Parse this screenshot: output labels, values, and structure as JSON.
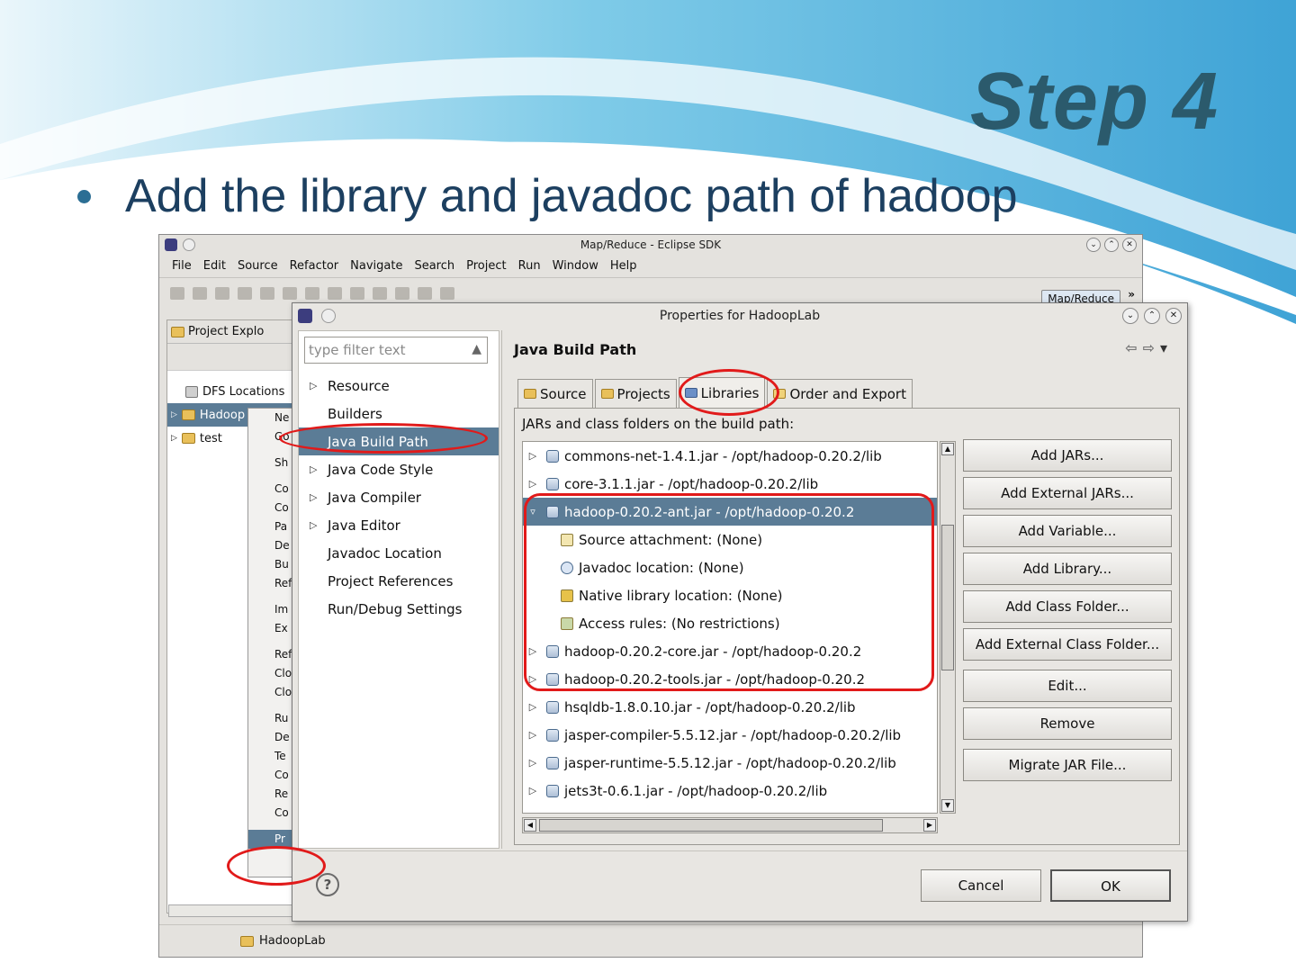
{
  "slide": {
    "title": "Step 4",
    "bullet": "Add the library and javadoc path of hadoop"
  },
  "eclipse": {
    "window_title": "Map/Reduce - Eclipse SDK",
    "menus": [
      "File",
      "Edit",
      "Source",
      "Refactor",
      "Navigate",
      "Search",
      "Project",
      "Run",
      "Window",
      "Help"
    ],
    "perspective": "Map/Reduce",
    "explorer_tab": "Project Explo",
    "tree": [
      {
        "label": "DFS Locations"
      },
      {
        "label": "Hadoop"
      },
      {
        "label": "test"
      }
    ],
    "context_menu": [
      "Ne",
      "Go",
      "Sh",
      "Co",
      "Co",
      "Pa",
      "De",
      "Bu",
      "Ref",
      "Im",
      "Ex",
      "Ref",
      "Clo",
      "Clo",
      "Ru",
      "De",
      "Te",
      "Co",
      "Re",
      "Co",
      "Pr"
    ],
    "status_project": "HadoopLab"
  },
  "dialog": {
    "title": "Properties for HadoopLab",
    "filter_placeholder": "type filter text",
    "nav_items": [
      {
        "label": "Resource",
        "expandable": true
      },
      {
        "label": "Builders",
        "expandable": false
      },
      {
        "label": "Java Build Path",
        "expandable": false,
        "selected": true
      },
      {
        "label": "Java Code Style",
        "expandable": true
      },
      {
        "label": "Java Compiler",
        "expandable": true
      },
      {
        "label": "Java Editor",
        "expandable": true
      },
      {
        "label": "Javadoc Location",
        "expandable": false
      },
      {
        "label": "Project References",
        "expandable": false
      },
      {
        "label": "Run/Debug Settings",
        "expandable": false
      }
    ],
    "page_title": "Java Build Path",
    "tabs": [
      "Source",
      "Projects",
      "Libraries",
      "Order and Export"
    ],
    "active_tab": "Libraries",
    "list_label": "JARs and class folders on the build path:",
    "jars": [
      {
        "label": "commons-net-1.4.1.jar - /opt/hadoop-0.20.2/lib",
        "type": "jar"
      },
      {
        "label": "core-3.1.1.jar - /opt/hadoop-0.20.2/lib",
        "type": "jar"
      },
      {
        "label": "hadoop-0.20.2-ant.jar - /opt/hadoop-0.20.2",
        "type": "jar",
        "expanded": true,
        "selected": true
      },
      {
        "label": "Source attachment: (None)",
        "type": "child"
      },
      {
        "label": "Javadoc location: (None)",
        "type": "child"
      },
      {
        "label": "Native library location: (None)",
        "type": "child"
      },
      {
        "label": "Access rules: (No restrictions)",
        "type": "child"
      },
      {
        "label": "hadoop-0.20.2-core.jar - /opt/hadoop-0.20.2",
        "type": "jar"
      },
      {
        "label": "hadoop-0.20.2-tools.jar - /opt/hadoop-0.20.2",
        "type": "jar"
      },
      {
        "label": "hsqldb-1.8.0.10.jar - /opt/hadoop-0.20.2/lib",
        "type": "jar"
      },
      {
        "label": "jasper-compiler-5.5.12.jar - /opt/hadoop-0.20.2/lib",
        "type": "jar"
      },
      {
        "label": "jasper-runtime-5.5.12.jar - /opt/hadoop-0.20.2/lib",
        "type": "jar"
      },
      {
        "label": "jets3t-0.6.1.jar - /opt/hadoop-0.20.2/lib",
        "type": "jar"
      }
    ],
    "buttons": {
      "add_jars": "Add JARs...",
      "add_external_jars": "Add External JARs...",
      "add_variable": "Add Variable...",
      "add_library": "Add Library...",
      "add_class_folder": "Add Class Folder...",
      "add_external_class_folder": "Add External Class Folder...",
      "edit": "Edit...",
      "remove": "Remove",
      "migrate": "Migrate JAR File..."
    },
    "footer": {
      "help": "?",
      "cancel": "Cancel",
      "ok": "OK"
    }
  },
  "colors": {
    "title": "#2b5a6c",
    "bullet": "#1c3f60",
    "selection": "#5b7c96",
    "annotation": "#e11a1a"
  }
}
